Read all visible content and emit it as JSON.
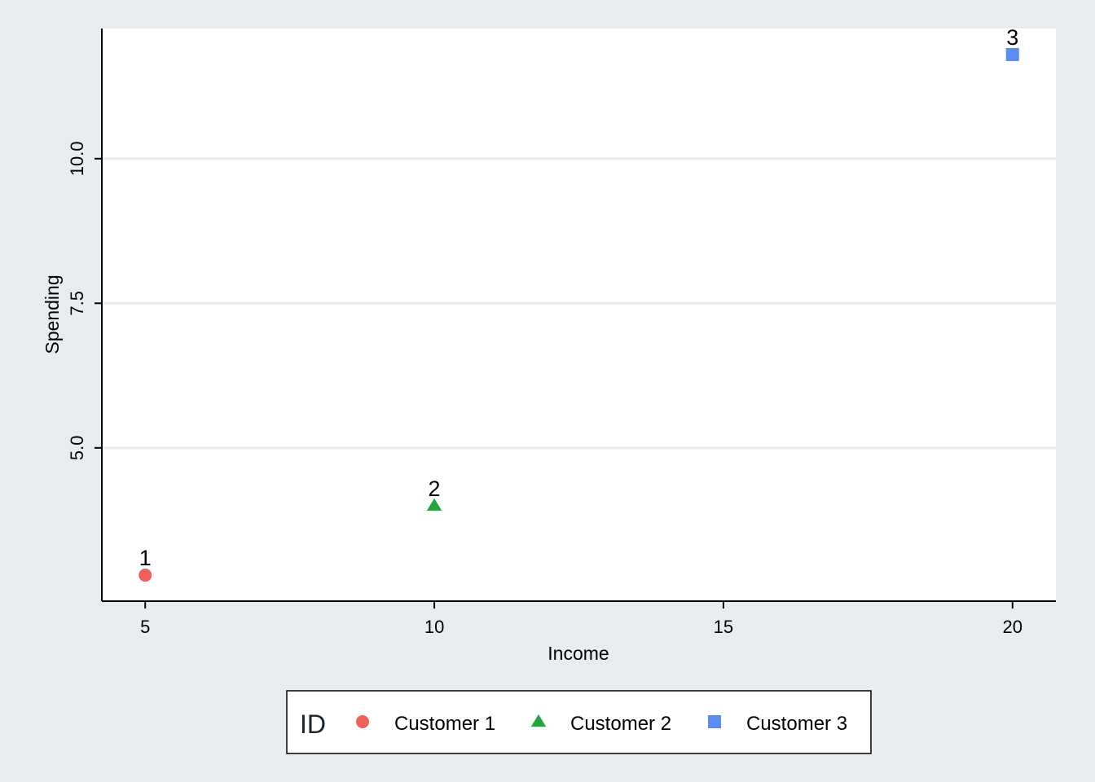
{
  "chart_data": {
    "type": "scatter",
    "title": "",
    "xlabel": "Income",
    "ylabel": "Spending",
    "xlim": [
      4.25,
      20.75
    ],
    "ylim": [
      2.35,
      12.25
    ],
    "x_ticks": [
      5,
      10,
      15,
      20
    ],
    "x_tick_labels": [
      "5",
      "10",
      "15",
      "20"
    ],
    "y_ticks": [
      5.0,
      7.5,
      10.0
    ],
    "y_tick_labels": [
      "5.0",
      "7.5",
      "10.0"
    ],
    "grid": "horizontal",
    "legend_position": "bottom",
    "legend_title": "ID",
    "series": [
      {
        "name": "Customer 1",
        "shape": "circle",
        "color": "#f0605a",
        "x": [
          5
        ],
        "y": [
          2.8
        ],
        "point_labels": [
          "1"
        ]
      },
      {
        "name": "Customer 2",
        "shape": "triangle",
        "color": "#1ea83a",
        "x": [
          10
        ],
        "y": [
          4.0
        ],
        "point_labels": [
          "2"
        ]
      },
      {
        "name": "Customer 3",
        "shape": "square",
        "color": "#5b8cf5",
        "x": [
          20
        ],
        "y": [
          11.8
        ],
        "point_labels": [
          "3"
        ]
      }
    ]
  }
}
